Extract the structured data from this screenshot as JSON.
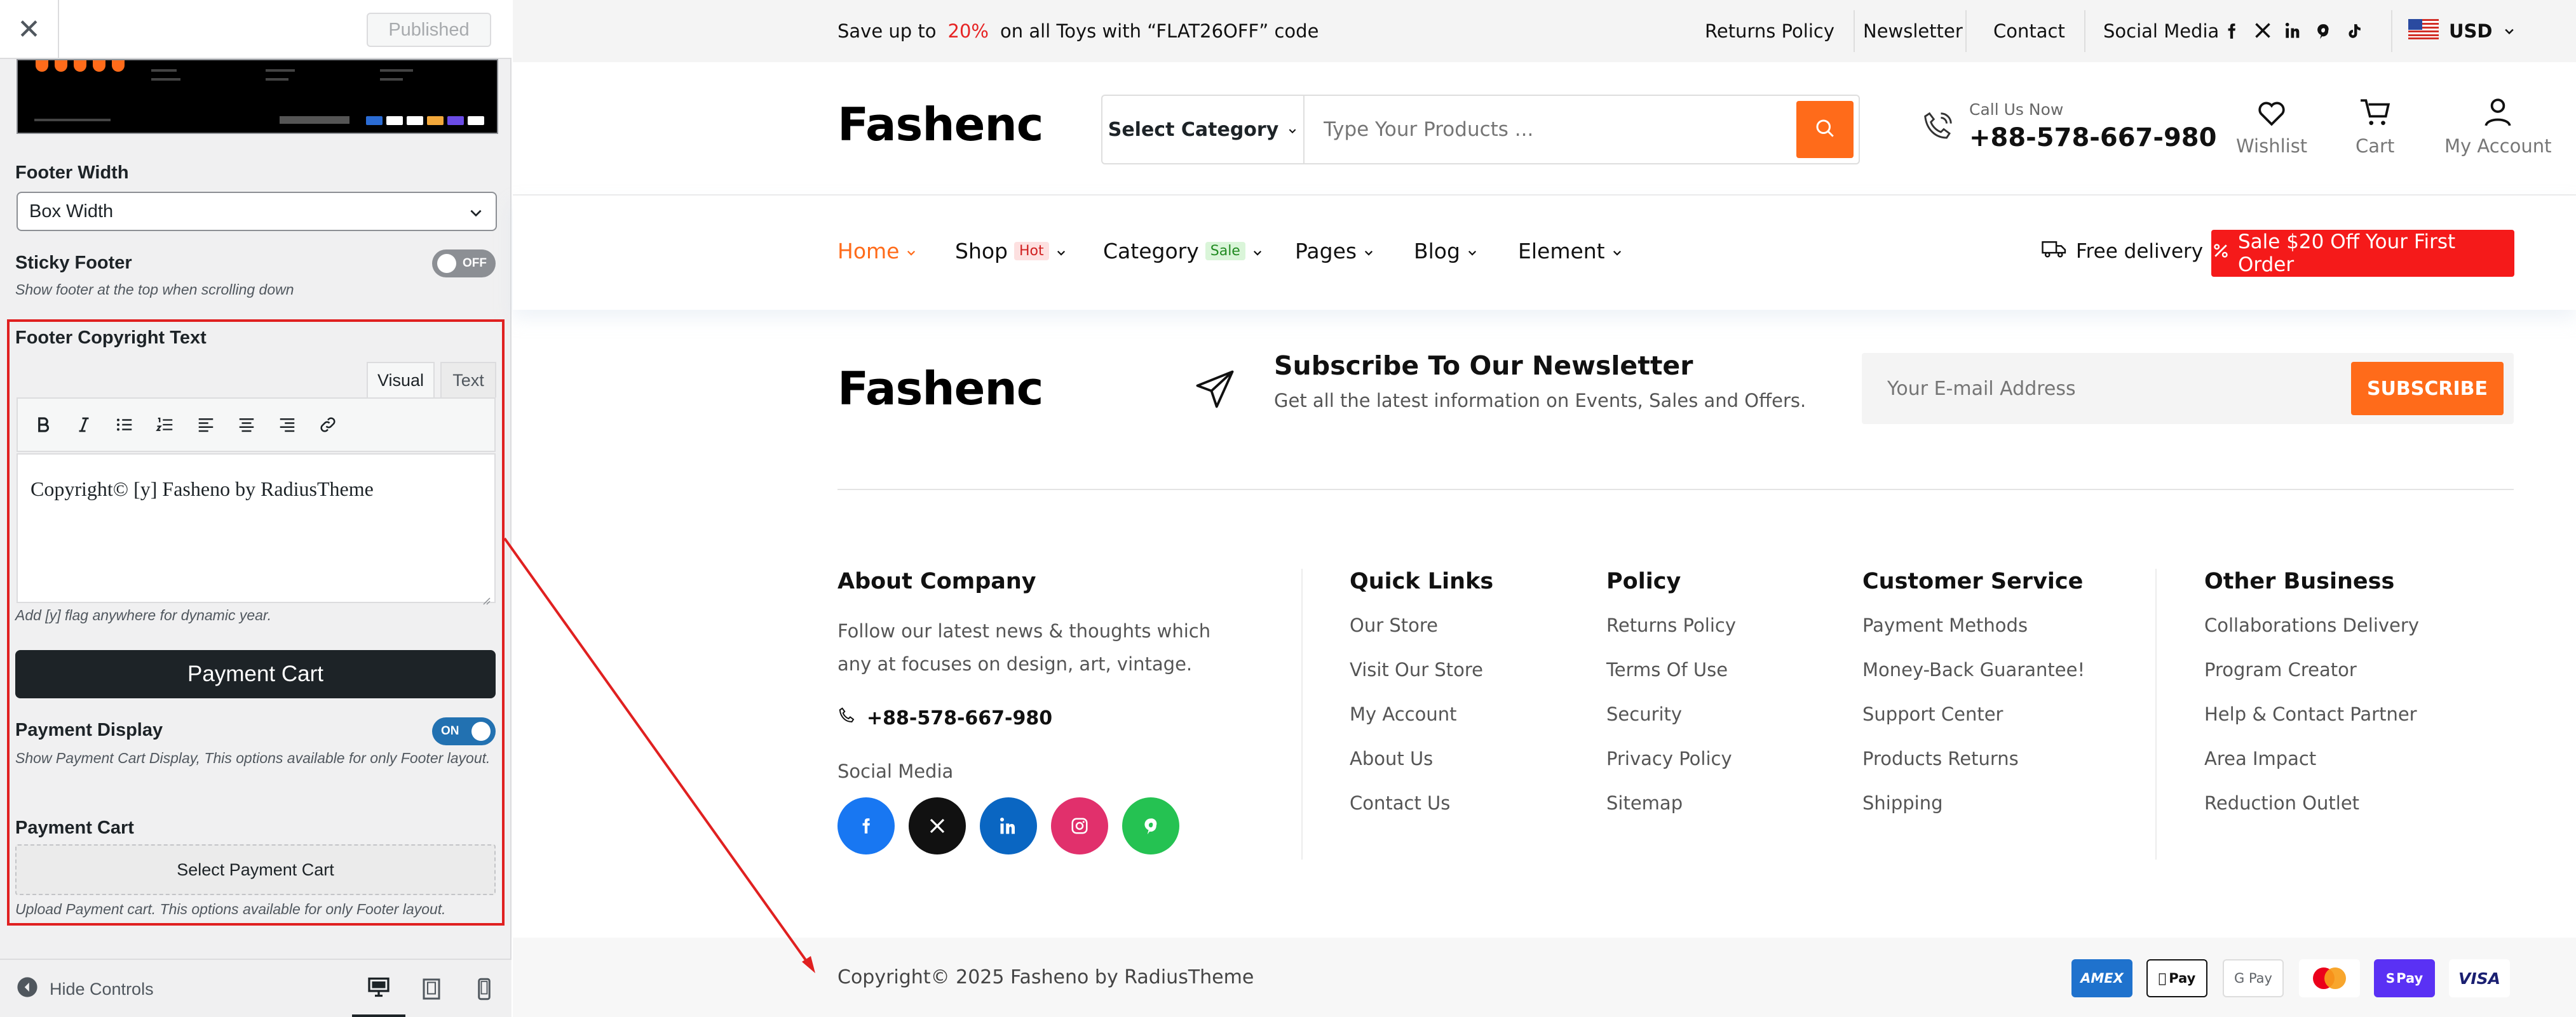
{
  "customizer": {
    "close_icon": "close-icon",
    "published_label": "Published",
    "footer_width": {
      "label": "Footer Width",
      "selected": "Box Width"
    },
    "sticky_footer": {
      "label": "Sticky Footer",
      "state": "OFF",
      "description": "Show footer at the top when scrolling down"
    },
    "copyright": {
      "label": "Footer Copyright Text",
      "tabs": [
        "Visual",
        "Text"
      ],
      "toolbar": [
        "bold-icon",
        "italic-icon",
        "bullet-list-icon",
        "numbered-list-icon",
        "align-left-icon",
        "align-center-icon",
        "align-right-icon",
        "link-icon"
      ],
      "content": "Copyright© [y] Fasheno by RadiusTheme",
      "description": "Add [y] flag anywhere for dynamic year."
    },
    "payment_cart_heading": "Payment Cart",
    "payment_display": {
      "label": "Payment Display",
      "state": "ON",
      "description": "Show Payment Cart Display, This options available for only Footer layout."
    },
    "payment_cart": {
      "label": "Payment Cart",
      "button": "Select Payment Cart",
      "description": "Upload Payment cart. This options available for only Footer layout."
    },
    "hide_controls": "Hide Controls",
    "devices": [
      "desktop-icon",
      "tablet-icon",
      "mobile-icon"
    ],
    "highlight_color": "#e02020"
  },
  "site": {
    "topbar": {
      "promo_before": "Save up to",
      "promo_pct": "20%",
      "promo_after": "on all Toys with “FLAT26OFF” code",
      "links": [
        "Returns Policy",
        "Newsletter",
        "Contact",
        "Social Media"
      ],
      "currency": "USD"
    },
    "header": {
      "logo": "Fashenc",
      "category_select": "Select Category",
      "search_placeholder": "Type Your Products ...",
      "call_label": "Call Us Now",
      "call_number": "+88-578-667-980",
      "actions": [
        "Wishlist",
        "Cart",
        "My Account"
      ]
    },
    "nav": {
      "items": [
        {
          "label": "Home",
          "active": true
        },
        {
          "label": "Shop",
          "badge": "Hot"
        },
        {
          "label": "Category",
          "badge": "Sale"
        },
        {
          "label": "Pages"
        },
        {
          "label": "Blog"
        },
        {
          "label": "Element"
        }
      ],
      "free_delivery": "Free delivery !",
      "sale_button": "Sale $20 Off Your First Order"
    },
    "newsletter": {
      "logo": "Fashenc",
      "heading": "Subscribe To Our Newsletter",
      "subtext": "Get all the latest information on Events, Sales and Offers.",
      "email_placeholder": "Your E-mail Address",
      "button": "SUBSCRIBE"
    },
    "footer": {
      "about": {
        "title": "About Company",
        "text": "Follow our latest news & thoughts which any at focuses on design, art, vintage.",
        "phone": "+88-578-667-980",
        "social_label": "Social Media"
      },
      "columns": [
        {
          "title": "Quick Links",
          "links": [
            "Our Store",
            "Visit Our Store",
            "My Account",
            "About Us",
            "Contact Us"
          ]
        },
        {
          "title": "Policy",
          "links": [
            "Returns Policy",
            "Terms Of Use",
            "Security",
            "Privacy Policy",
            "Sitemap"
          ]
        },
        {
          "title": "Customer Service",
          "links": [
            "Payment Methods",
            "Money-Back Guarantee!",
            "Support Center",
            "Products Returns",
            "Shipping"
          ]
        },
        {
          "title": "Other Business",
          "links": [
            "Collaborations Delivery",
            "Program Creator",
            "Help & Contact Partner",
            "Area Impact",
            "Reduction Outlet"
          ]
        }
      ],
      "copyright": "Copyright© 2025 Fasheno by RadiusTheme",
      "payment_cards": [
        "AMEX",
        "Pay",
        "G Pay",
        "",
        "Pay",
        "VISA"
      ]
    },
    "colors": {
      "accent": "#ff6b1a",
      "sale": "#f51a1a",
      "promo": "#e62323"
    }
  }
}
